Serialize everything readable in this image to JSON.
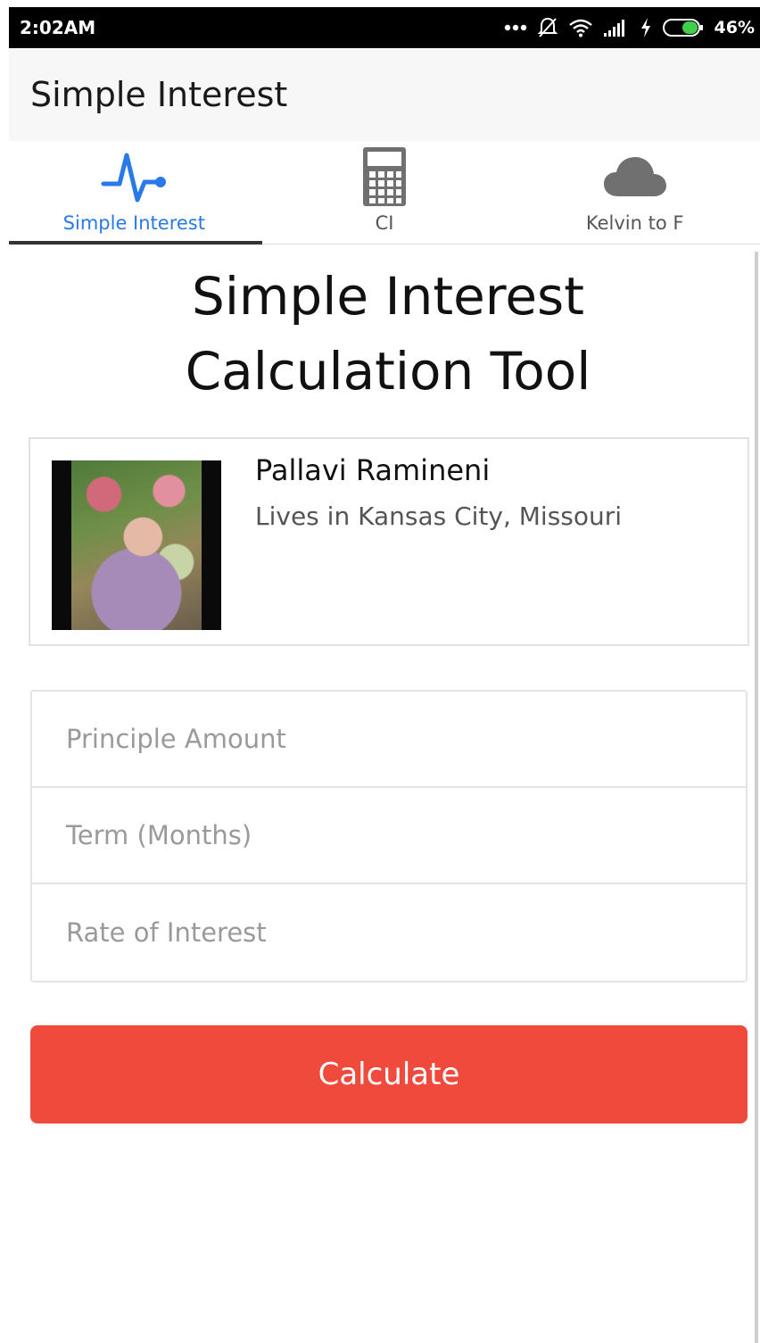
{
  "status_bar": {
    "time": "2:02AM",
    "battery": "46%",
    "icons": [
      "more-dots-icon",
      "notifications-off-icon",
      "wifi-icon",
      "signal-icon",
      "charging-icon",
      "battery-icon"
    ]
  },
  "app_bar": {
    "title": "Simple Interest"
  },
  "tabs": [
    {
      "label": "Simple Interest",
      "icon": "pulse-icon",
      "active": true
    },
    {
      "label": "CI",
      "icon": "calculator-icon",
      "active": false
    },
    {
      "label": "Kelvin to F",
      "icon": "cloud-icon",
      "active": false
    }
  ],
  "main": {
    "heading_line1": "Simple Interest",
    "heading_line2": "Calculation Tool",
    "profile": {
      "name": "Pallavi Ramineni",
      "location": "Lives in Kansas City, Missouri"
    },
    "form": {
      "principle_placeholder": "Principle Amount",
      "term_placeholder": "Term (Months)",
      "rate_placeholder": "Rate of Interest"
    },
    "calculate_label": "Calculate"
  },
  "colors": {
    "accent": "#2979e8",
    "button": "#ef4a3c",
    "icon_gray": "#707070"
  }
}
